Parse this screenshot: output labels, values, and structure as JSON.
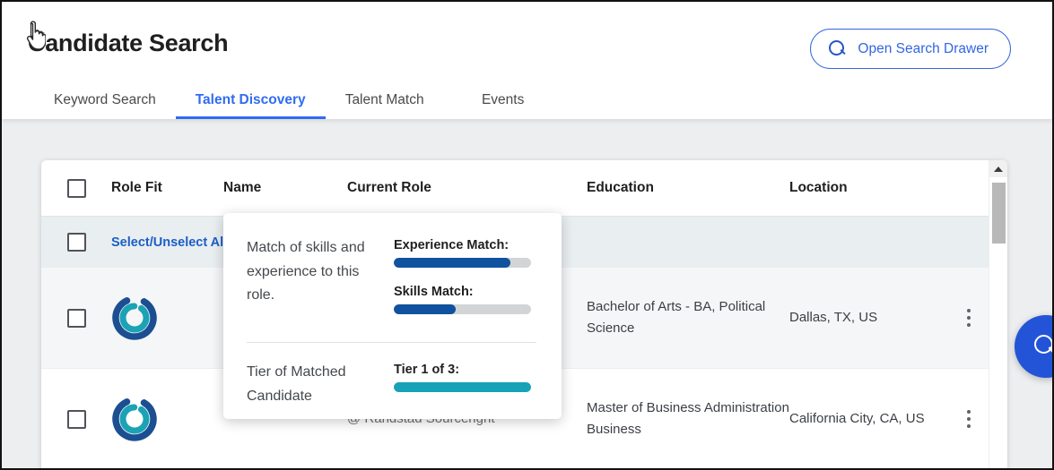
{
  "header": {
    "title": "Candidate Search",
    "search_drawer_button": "Open Search Drawer",
    "search_icon": "search-icon"
  },
  "tabs": [
    {
      "label": "Keyword Search",
      "active": false
    },
    {
      "label": "Talent Discovery",
      "active": true
    },
    {
      "label": "Talent Match",
      "active": false
    },
    {
      "label": "Events",
      "active": false
    }
  ],
  "table": {
    "columns": [
      {
        "key": "checkbox",
        "label": ""
      },
      {
        "key": "role_fit",
        "label": "Role Fit"
      },
      {
        "key": "name",
        "label": "Name"
      },
      {
        "key": "current_role",
        "label": "Current Role"
      },
      {
        "key": "education",
        "label": "Education"
      },
      {
        "key": "location",
        "label": "Location"
      }
    ],
    "select_all_label": "Select/Unselect All",
    "rows": [
      {
        "role_fit_icon": "role-fit-donut-icon",
        "name": "",
        "current_role": "",
        "current_company": "",
        "education": "Bachelor of Arts - BA, Political Science",
        "location": "Dallas, TX, US",
        "menu_icon": "kebab-menu-icon"
      },
      {
        "role_fit_icon": "role-fit-donut-icon",
        "name": "",
        "current_role": "",
        "current_company": "@ Randstad Sourceright",
        "education": "Master of Business Administration Business",
        "location": "California City, CA, US",
        "menu_icon": "kebab-menu-icon"
      }
    ]
  },
  "tooltip": {
    "skills_description": "Match of skills and experience to this role.",
    "experience_match_label": "Experience Match:",
    "experience_match_percent": 85,
    "skills_match_label": "Skills Match:",
    "skills_match_percent": 45,
    "tier_description": "Tier of Matched Candidate",
    "tier_label": "Tier 1 of 3:",
    "tier_percent": 100
  },
  "fab": {
    "icon": "search-icon"
  },
  "scrollbar": {
    "up_arrow_icon": "chevron-up-icon"
  },
  "colors": {
    "accent_blue": "#2f6cf0",
    "link_blue": "#1a5ec8",
    "bar_navy": "#10529e",
    "bar_teal": "#17a2b8",
    "bar_track": "#d2d4d6",
    "donut_outer": "#1b4f91",
    "donut_inner": "#1ba3b5",
    "fab_blue": "#2354d8"
  }
}
